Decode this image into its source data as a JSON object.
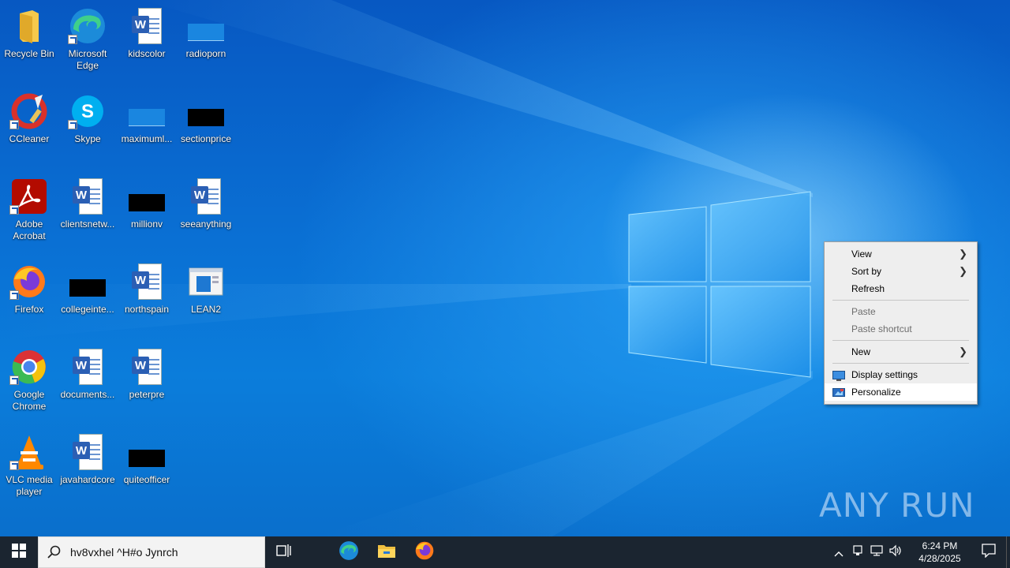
{
  "desktop": {
    "icons": [
      {
        "label": "Recycle Bin",
        "icon": "folder-icon"
      },
      {
        "label": "Microsoft Edge",
        "icon": "edge-icon"
      },
      {
        "label": "kidscolor",
        "icon": "word-doc-icon"
      },
      {
        "label": "radioporn",
        "icon": "blue-thumbnail-icon"
      },
      {
        "label": "CCleaner",
        "icon": "ccleaner-icon"
      },
      {
        "label": "Skype",
        "icon": "skype-icon"
      },
      {
        "label": "maximuml...",
        "icon": "blue-thumbnail-icon"
      },
      {
        "label": "sectionprice",
        "icon": "black-thumbnail-icon"
      },
      {
        "label": "Adobe Acrobat",
        "icon": "acrobat-icon"
      },
      {
        "label": "clientsnetw...",
        "icon": "word-doc-icon"
      },
      {
        "label": "millionv",
        "icon": "black-thumbnail-icon"
      },
      {
        "label": "seeanything",
        "icon": "word-doc-icon"
      },
      {
        "label": "Firefox",
        "icon": "firefox-icon"
      },
      {
        "label": "collegeinte...",
        "icon": "black-thumbnail-icon"
      },
      {
        "label": "northspain",
        "icon": "word-doc-icon"
      },
      {
        "label": "LEAN2",
        "icon": "window-app-icon"
      },
      {
        "label": "Google Chrome",
        "icon": "chrome-icon"
      },
      {
        "label": "documents...",
        "icon": "word-doc-icon"
      },
      {
        "label": "peterpre",
        "icon": "word-doc-icon"
      },
      {
        "label": "VLC media player",
        "icon": "vlc-icon"
      },
      {
        "label": "javahardcore",
        "icon": "word-doc-icon"
      },
      {
        "label": "quiteofficer",
        "icon": "black-thumbnail-icon"
      }
    ]
  },
  "context_menu": {
    "view": "View",
    "sort_by": "Sort by",
    "refresh": "Refresh",
    "paste": "Paste",
    "paste_shortcut": "Paste shortcut",
    "new": "New",
    "display_settings": "Display settings",
    "personalize": "Personalize",
    "submenu_arrow": "❯"
  },
  "watermark": {
    "text": "ANY RUN"
  },
  "taskbar": {
    "search_value": "hv8vxhel ^H#o Jynrch",
    "clock_time": "6:24 PM",
    "clock_date": "4/28/2025"
  },
  "colors": {
    "taskbar_bg": "#1b2530",
    "menu_bg": "#eeeeee",
    "desktop_accent": "#0a78d6"
  }
}
